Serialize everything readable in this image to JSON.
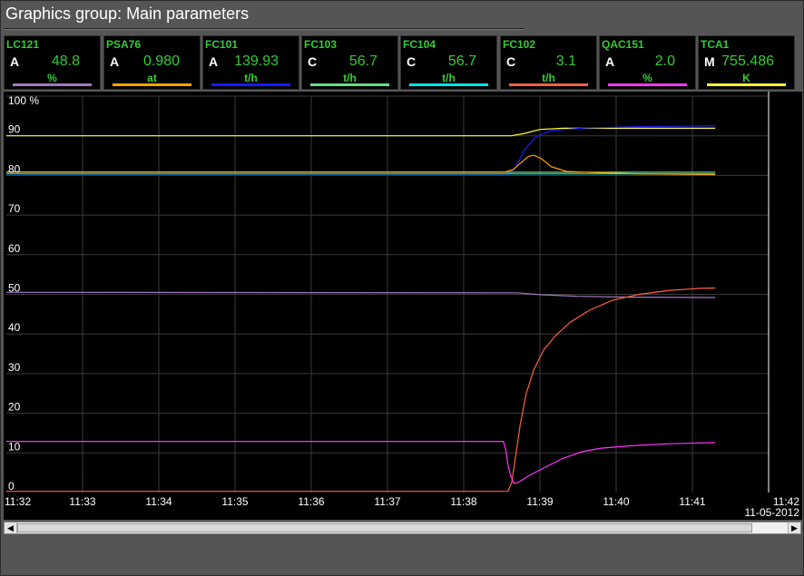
{
  "title": "Graphics group: Main parameters",
  "params": [
    {
      "name": "LC121",
      "mode": "A",
      "value": "48.8",
      "unit": "%",
      "color": "#a07ac0"
    },
    {
      "name": "PSA76",
      "mode": "A",
      "value": "0.980",
      "unit": "at",
      "color": "#ffa500"
    },
    {
      "name": "FC101",
      "mode": "A",
      "value": "139.93",
      "unit": "t/h",
      "color": "#1a1aff"
    },
    {
      "name": "FC103",
      "mode": "C",
      "value": "56.7",
      "unit": "t/h",
      "color": "#66dd88"
    },
    {
      "name": "FC104",
      "mode": "C",
      "value": "56.7",
      "unit": "t/h",
      "color": "#00e5e5"
    },
    {
      "name": "FC102",
      "mode": "C",
      "value": "3.1",
      "unit": "t/h",
      "color": "#ff6040"
    },
    {
      "name": "QAC151",
      "mode": "A",
      "value": "2.0",
      "unit": "%",
      "color": "#ff33ff"
    },
    {
      "name": "TCA1",
      "mode": "M",
      "value": "755.486",
      "unit": "K",
      "color": "#ffff33"
    }
  ],
  "chart_data": {
    "type": "line",
    "y_unit_label": "100 %",
    "ylim": [
      0,
      100
    ],
    "y_ticks": [
      0,
      10,
      20,
      30,
      40,
      50,
      60,
      70,
      80,
      90
    ],
    "x_ticks": [
      "11:32",
      "11:33",
      "11:34",
      "11:35",
      "11:36",
      "11:37",
      "11:38",
      "11:39",
      "11:40",
      "11:41",
      "11:42"
    ],
    "date": "11-05-2012",
    "grid": true,
    "series": [
      {
        "param": "TCA1",
        "color": "#ffff33",
        "points": [
          [
            0,
            90
          ],
          [
            6.62,
            90
          ],
          [
            6.78,
            90.5
          ],
          [
            7.0,
            91.6
          ],
          [
            7.3,
            91.9
          ],
          [
            9.3,
            91.9
          ]
        ]
      },
      {
        "param": "FC101",
        "color": "#1a1aff",
        "points": [
          [
            0,
            80
          ],
          [
            6.58,
            80
          ],
          [
            6.68,
            82
          ],
          [
            6.8,
            86.5
          ],
          [
            6.95,
            89.8
          ],
          [
            7.15,
            91.3
          ],
          [
            7.6,
            92.0
          ],
          [
            8.3,
            92.3
          ],
          [
            9.3,
            92.5
          ]
        ]
      },
      {
        "param": "FC103",
        "color": "#66dd88",
        "points": [
          [
            0,
            80.8
          ],
          [
            9.3,
            80.8
          ]
        ]
      },
      {
        "param": "FC104",
        "color": "#00e5e5",
        "points": [
          [
            0,
            80.4
          ],
          [
            9.3,
            80.4
          ]
        ]
      },
      {
        "param": "PSA76",
        "color": "#ffa500",
        "points": [
          [
            0,
            80.9
          ],
          [
            6.55,
            80.9
          ],
          [
            6.65,
            81.5
          ],
          [
            6.75,
            83.2
          ],
          [
            6.85,
            84.8
          ],
          [
            6.92,
            85.1
          ],
          [
            7.02,
            84.2
          ],
          [
            7.15,
            82.2
          ],
          [
            7.35,
            81.0
          ],
          [
            7.7,
            80.7
          ],
          [
            8.3,
            80.4
          ],
          [
            9.3,
            80.2
          ]
        ]
      },
      {
        "param": "LC121",
        "color": "#a07ac0",
        "points": [
          [
            0,
            50.5
          ],
          [
            6.7,
            50.4
          ],
          [
            7.0,
            49.9
          ],
          [
            7.5,
            49.5
          ],
          [
            8.2,
            49.3
          ],
          [
            9.3,
            49.2
          ]
        ]
      },
      {
        "param": "FC102",
        "color": "#ff6040",
        "points": [
          [
            0,
            0.3
          ],
          [
            6.58,
            0.3
          ],
          [
            6.63,
            2.5
          ],
          [
            6.68,
            9
          ],
          [
            6.74,
            17
          ],
          [
            6.82,
            25
          ],
          [
            6.92,
            31
          ],
          [
            7.05,
            36
          ],
          [
            7.2,
            39.5
          ],
          [
            7.4,
            43
          ],
          [
            7.65,
            46
          ],
          [
            7.95,
            48.5
          ],
          [
            8.3,
            50
          ],
          [
            8.7,
            51
          ],
          [
            9.1,
            51.5
          ],
          [
            9.3,
            51.6
          ]
        ]
      },
      {
        "param": "QAC151",
        "color": "#ff33ff",
        "points": [
          [
            0,
            12.9
          ],
          [
            6.52,
            12.9
          ],
          [
            6.55,
            11
          ],
          [
            6.58,
            7
          ],
          [
            6.62,
            4
          ],
          [
            6.66,
            2.3
          ],
          [
            6.72,
            2.6
          ],
          [
            6.85,
            4.2
          ],
          [
            7.05,
            6.2
          ],
          [
            7.3,
            8.6
          ],
          [
            7.55,
            10.3
          ],
          [
            7.8,
            11.2
          ],
          [
            8.2,
            11.8
          ],
          [
            8.7,
            12.3
          ],
          [
            9.3,
            12.6
          ]
        ]
      }
    ]
  }
}
